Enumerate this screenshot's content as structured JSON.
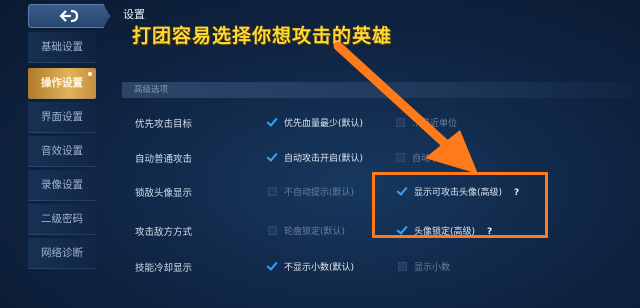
{
  "header": {
    "title": "设置",
    "overlay_caption": "打团容易选择你想攻击的英雄"
  },
  "sidebar": {
    "items": [
      {
        "label": "基础设置"
      },
      {
        "label": "操作设置"
      },
      {
        "label": "界面设置"
      },
      {
        "label": "音效设置"
      },
      {
        "label": "录像设置"
      },
      {
        "label": "二级密码"
      },
      {
        "label": "网络诊断"
      }
    ],
    "active_index": 1
  },
  "section": {
    "title": "高级选项"
  },
  "rows": [
    {
      "label": "优先攻击目标",
      "options": [
        {
          "text": "优先血量最少(默认)",
          "checked": true
        },
        {
          "text": "…最近单位",
          "checked": false
        }
      ]
    },
    {
      "label": "自动普通攻击",
      "options": [
        {
          "text": "自动攻击开启(默认)",
          "checked": true
        },
        {
          "text": "自动攻…",
          "checked": false
        }
      ]
    },
    {
      "label": "锁敌头像显示",
      "options": [
        {
          "text": "不自动提示(默认)",
          "checked": false
        },
        {
          "text": "显示可攻击头像(高级)",
          "checked": true,
          "help": "?"
        }
      ]
    },
    {
      "label": "攻击敌方方式",
      "options": [
        {
          "text": "轮盘锁定(默认)",
          "checked": false
        },
        {
          "text": "头像锁定(高级)",
          "checked": true,
          "help": "?"
        }
      ]
    },
    {
      "label": "技能冷却显示",
      "options": [
        {
          "text": "不显示小数(默认)",
          "checked": true
        },
        {
          "text": "显示小数",
          "checked": false
        }
      ]
    }
  ],
  "colors": {
    "accent_check": "#37a4ff",
    "highlight": "#ff7a1a",
    "active_tab": "#e2b35a"
  }
}
